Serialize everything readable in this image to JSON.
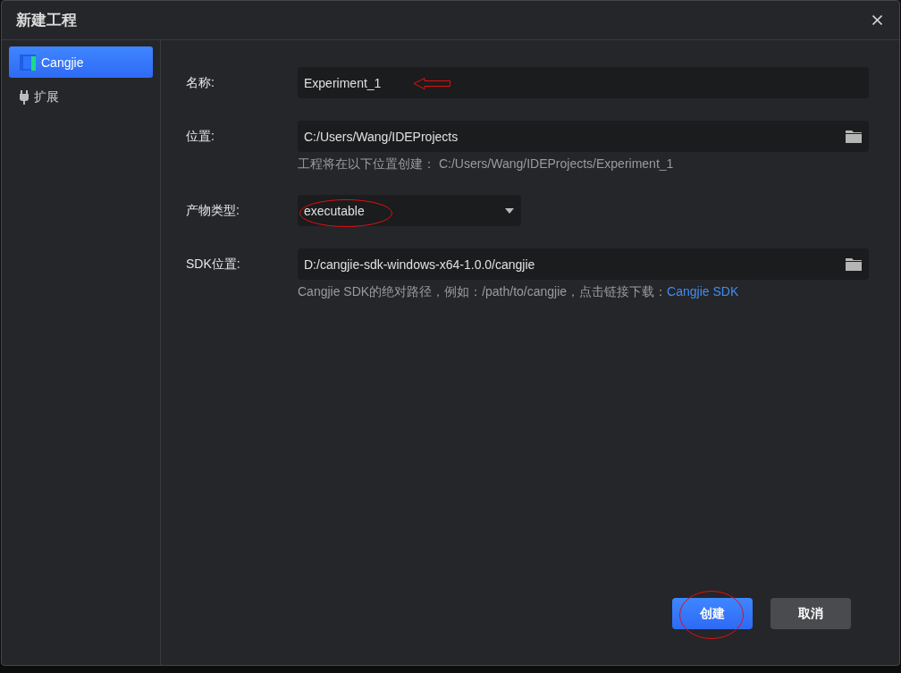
{
  "window": {
    "title": "新建工程"
  },
  "sidebar": {
    "items": [
      {
        "label": "Cangjie",
        "kind": "logo",
        "selected": true
      },
      {
        "label": "扩展",
        "kind": "plug",
        "selected": false
      }
    ]
  },
  "form": {
    "fields": [
      {
        "label": "名称:",
        "kind": "text",
        "value": "Experiment_1",
        "arrow_mark": true
      },
      {
        "label": "位置:",
        "kind": "folder",
        "value": "C:/Users/Wang/IDEProjects",
        "hint": "工程将在以下位置创建：  C:/Users/Wang/IDEProjects/Experiment_1"
      },
      {
        "label": "产物类型:",
        "kind": "select",
        "value": "executable",
        "circled": true
      },
      {
        "label": "SDK位置:",
        "kind": "folder",
        "value": "D:/cangjie-sdk-windows-x64-1.0.0/cangjie",
        "hint": "Cangjie SDK的绝对路径，例如：/path/to/cangjie，点击链接下载：",
        "link": "Cangjie SDK"
      }
    ]
  },
  "buttons": [
    {
      "label": "创建",
      "kind": "primary",
      "circled": true
    },
    {
      "label": "取消",
      "kind": "secondary"
    }
  ]
}
